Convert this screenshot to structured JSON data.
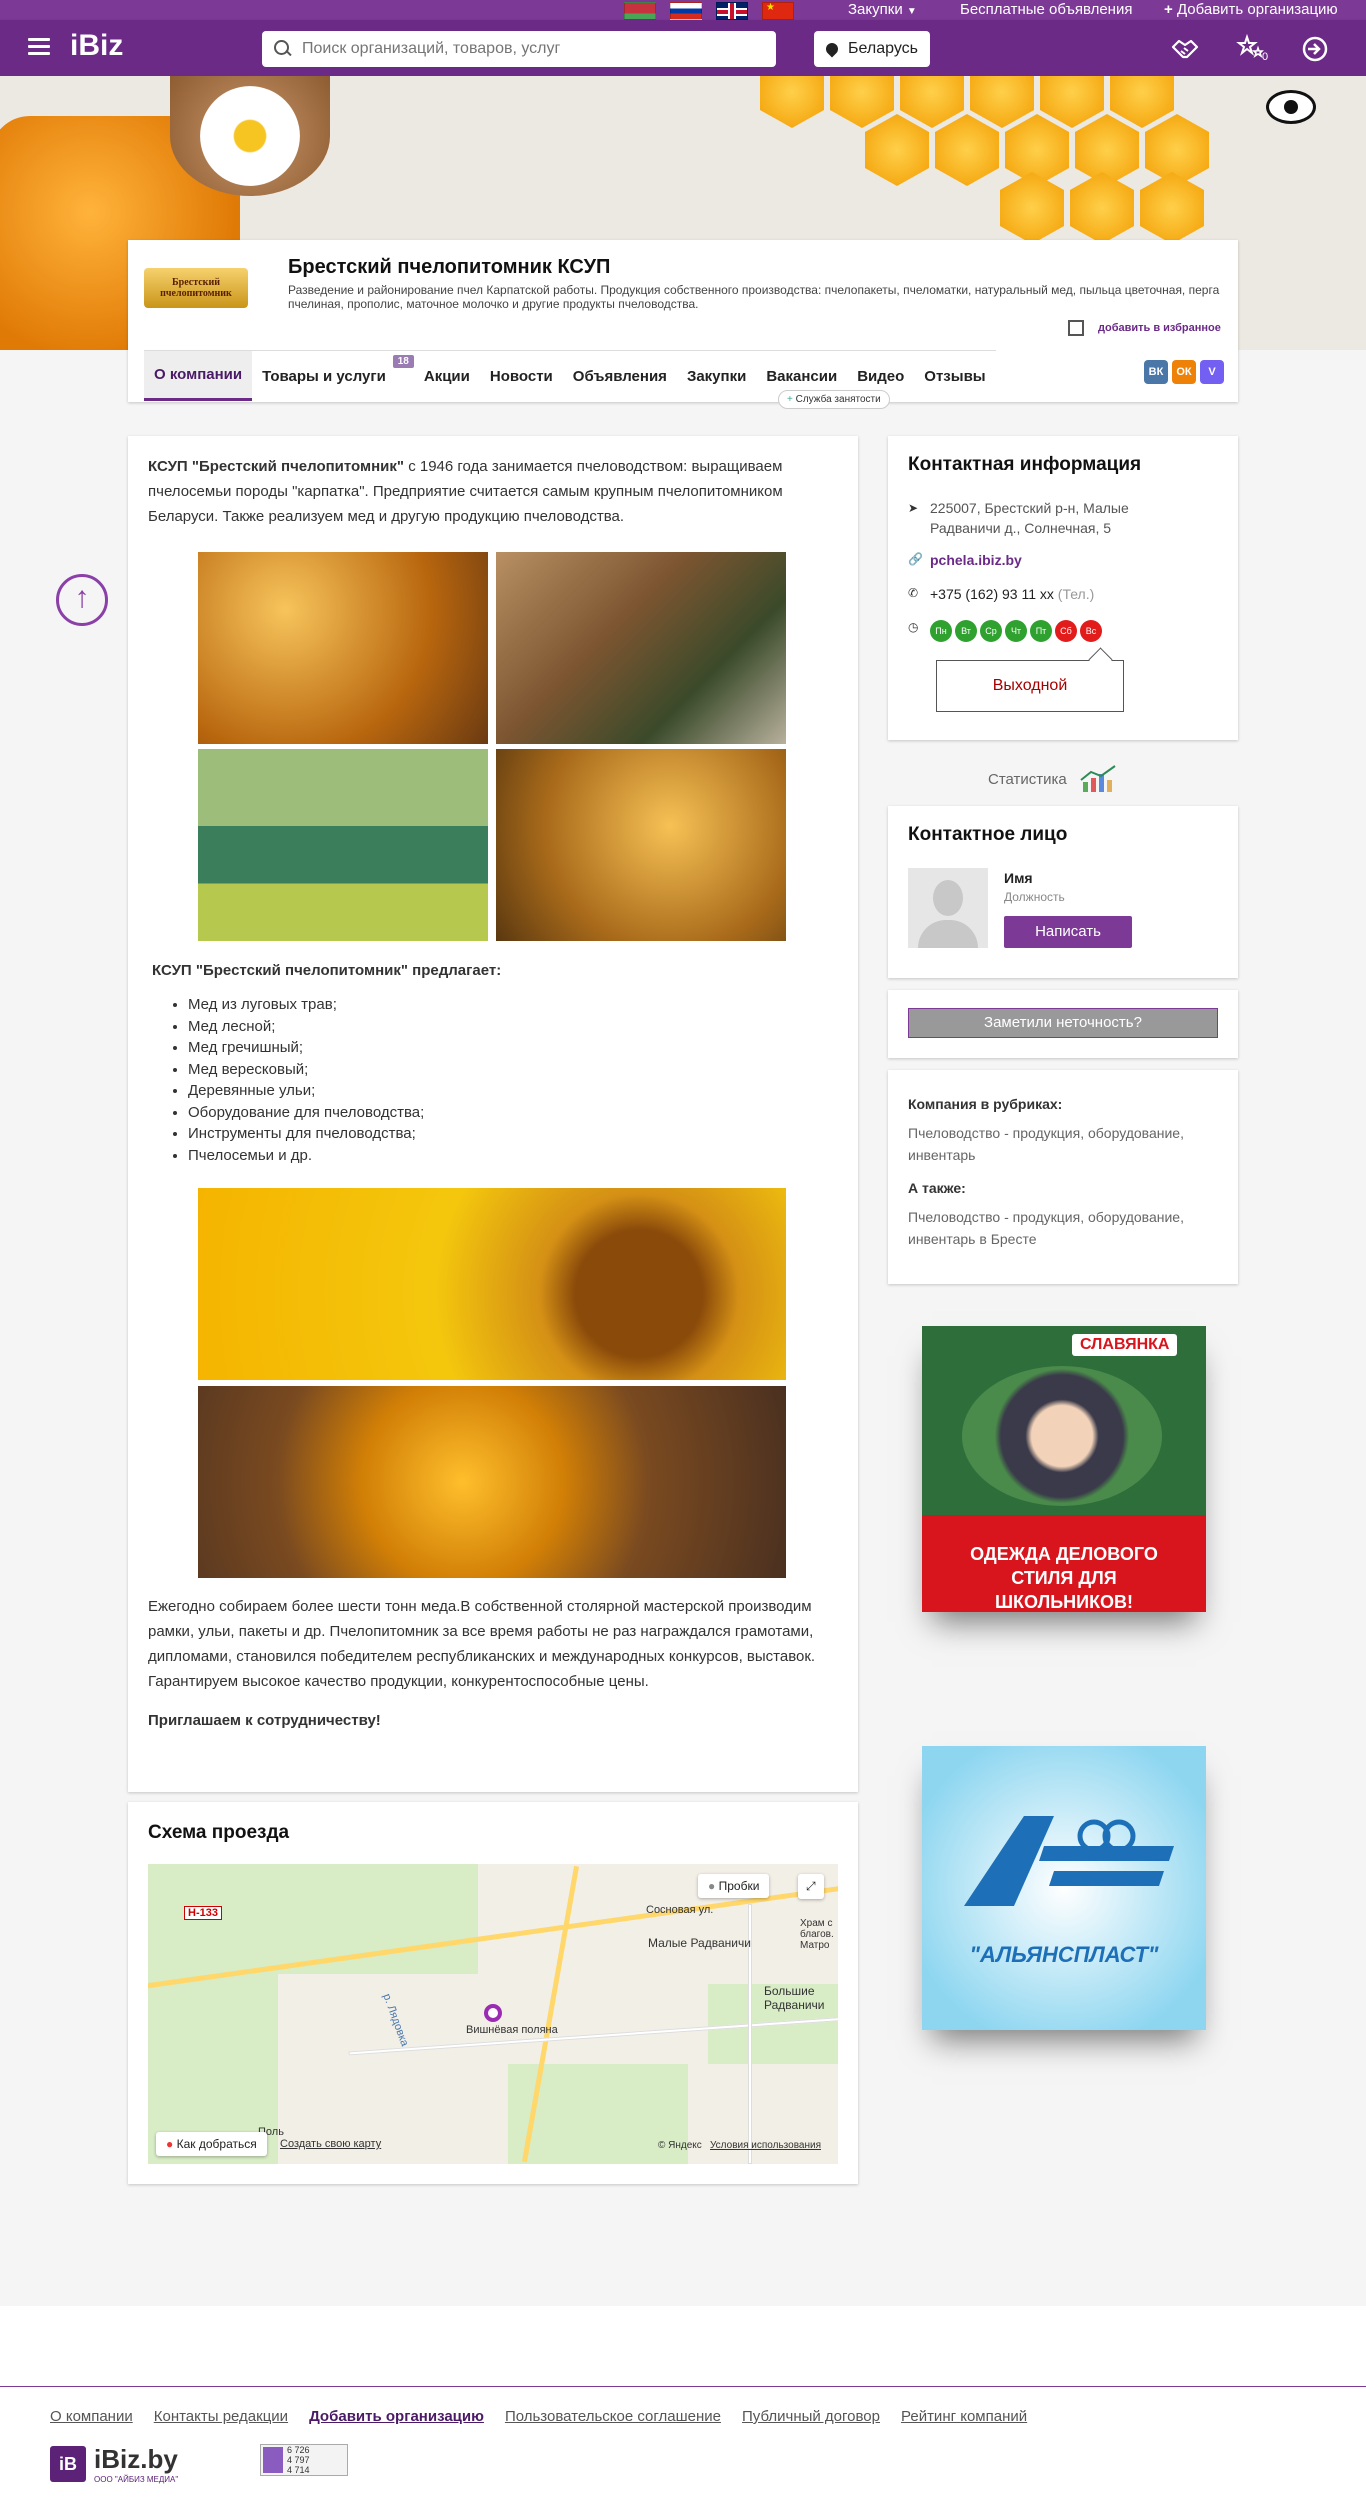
{
  "topbar": {
    "flags": [
      "by",
      "ru",
      "gb",
      "cn"
    ],
    "purchases_label": "Закупки",
    "free_ads": "Бесплатные объявления",
    "add_org": "Добавить организацию"
  },
  "header": {
    "logo": "iBiz",
    "search_placeholder": "Поиск организаций, товаров, услуг",
    "region": "Беларусь",
    "favorites_count": "0"
  },
  "company": {
    "logo_line1": "Брестский",
    "logo_line2": "пчелопитомник",
    "name": "Брестский пчелопитомник КСУП",
    "description": "Разведение и районирование пчел Карпатской работы. Продукция собственного производства: пчелопакеты, пчеломатки, натуральный мед, пыльца цветочная, перга пчелиная, прополис, маточное молочко и другие продукты пчеловодства.",
    "favorite_label": "добавить в избранное",
    "tabs": [
      {
        "label": "О компании"
      },
      {
        "label": "Товары и услуги",
        "count": "18"
      },
      {
        "label": "Акции"
      },
      {
        "label": "Новости"
      },
      {
        "label": "Объявления"
      },
      {
        "label": "Закупки"
      },
      {
        "label": "Вакансии"
      },
      {
        "label": "Видео"
      },
      {
        "label": "Отзывы"
      }
    ],
    "employment_badge": "Служба занятости",
    "socials": [
      {
        "name": "vk",
        "label": "ВК",
        "color": "#4a76a8"
      },
      {
        "name": "ok",
        "label": "ОК",
        "color": "#ee8208"
      },
      {
        "name": "viber",
        "label": "V",
        "color": "#7360f2"
      }
    ]
  },
  "about": {
    "intro_bold": "КСУП \"Брестский пчелопитомник\"",
    "intro_rest": " с 1946 года занимается пчеловодством: выращиваем пчелосемьи породы \"карпатка\". Предприятие считается самым крупным пчелопитомником Беларуси. Также реализуем мед и другую продукцию пчеловодства.",
    "offers_heading": "КСУП \"Брестский пчелопитомник\" предлагает:",
    "offers": [
      "Мед из луговых трав;",
      "Мед лесной;",
      "Мед  гречишный;",
      "Мед вересковый;",
      "Деревянные ульи;",
      "Оборудование для пчеловодства;",
      "Инструменты для пчеловодства;",
      "Пчелосемьи и др."
    ],
    "closing": "Ежегодно собираем более  шести тонн меда.В собственной столярной мастерской производим рамки, ульи, пакеты и др. Пчелопитомник за все время работы не раз награждался грамотами, дипломами, становился победителем республиканских и международных конкурсов, выставок. Гарантируем высокое качество продукции, конкурентоспособные цены.",
    "invite": "Приглашаем к сотрудничеству!"
  },
  "map": {
    "title": "Схема проезда",
    "traffic": "Пробки",
    "route": "Как добраться",
    "create_map": "Создать свою карту",
    "copyright": "© Яндекс",
    "terms": "Условия использования",
    "labels": {
      "road": "Н-133",
      "street": "Сосновая ул.",
      "village1": "Малые Радваничи",
      "village2": "Большие Радваничи",
      "place": "Вишнёвая поляна",
      "river": "р. Лядовка",
      "church": "Храм с благов. Матро",
      "other": "Поль"
    }
  },
  "contacts": {
    "title": "Контактная информация",
    "address": "225007, Брестский р-н, Малые Радваничи д., Солнечная, 5",
    "site": "pchela.ibiz.by",
    "phone": "+375 (162) 93 11 xx",
    "phone_type": "(Тел.)",
    "days": [
      {
        "label": "Пн",
        "open": true
      },
      {
        "label": "Вт",
        "open": true
      },
      {
        "label": "Ср",
        "open": true
      },
      {
        "label": "Чт",
        "open": true
      },
      {
        "label": "Пт",
        "open": true
      },
      {
        "label": "Сб",
        "open": false
      },
      {
        "label": "Вс",
        "open": false
      }
    ],
    "day_off": "Выходной"
  },
  "stats_label": "Статистика",
  "contact_person": {
    "title": "Контактное лицо",
    "name": "Имя",
    "position": "Должность",
    "write": "Написать"
  },
  "inaccuracy": "Заметили неточность?",
  "rubrics": {
    "heading": "Компания в рубриках:",
    "item": "Пчеловодство - продукция, оборудование, инвентарь",
    "also_heading": "А также:",
    "also_item": "Пчеловодство - продукция, оборудование, инвентарь в Бресте"
  },
  "ads": {
    "ad1_brand": "СЛАВЯНКА",
    "ad1_text": "ОДЕЖДА ДЕЛОВОГО СТИЛЯ ДЛЯ ШКОЛЬНИКОВ!",
    "ad2_brand": "\"АЛЬЯНСПЛАСТ\""
  },
  "footer": {
    "links": [
      "О компании",
      "Контакты редакции",
      "Добавить организацию",
      "Пользовательское соглашение",
      "Публичный договор",
      "Рейтинг компаний"
    ],
    "logo": "iBiz.by",
    "logo_sub": "ООО \"АЙБИЗ МЕДИА\"",
    "counter": [
      "6 726",
      "4 797",
      "4 714"
    ]
  }
}
